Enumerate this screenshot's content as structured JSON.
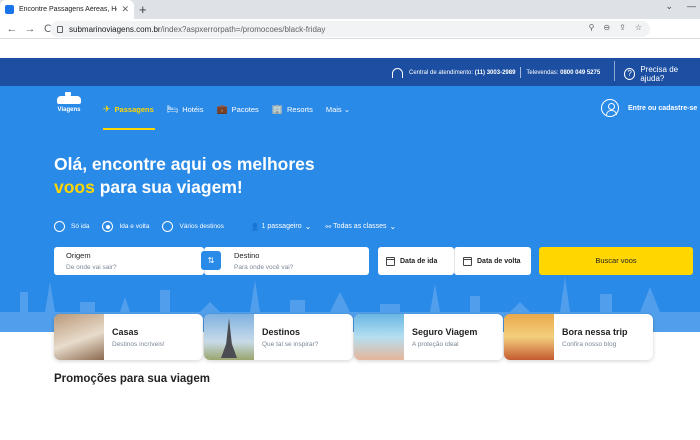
{
  "browser": {
    "tab_title": "Encontre Passagens Aéreas, Hoté",
    "tab_close": "✕",
    "new_tab": "+",
    "window_controls": [
      "⌄",
      "—"
    ],
    "url_host": "submarinoviagens.com.br",
    "url_path": "/index?aspxerrorpath=/promocoes/black-friday",
    "nav_back": "←",
    "nav_forward": "→",
    "nav_reload": "C",
    "omni_icons": [
      "⚲",
      "⊖",
      "⇪",
      "☆"
    ]
  },
  "topbar": {
    "central_label": "Central de atendimento:",
    "central_number": "(11) 3003-2989",
    "televendas_label": "Televendas:",
    "televendas_number": "0800 049 5275",
    "help": "Precisa de ajuda?"
  },
  "logo": {
    "text": "Viagens"
  },
  "nav": {
    "items": [
      {
        "label": "Passagens",
        "icon": "✈"
      },
      {
        "label": "Hotéis",
        "icon": "🛏"
      },
      {
        "label": "Pacotes",
        "icon": "💼"
      },
      {
        "label": "Resorts",
        "icon": "🏢"
      },
      {
        "label": "Mais",
        "icon": "⌄"
      }
    ],
    "account": "Entre ou cadastre-se"
  },
  "hero": {
    "line1": "Olá, encontre aqui os melhores",
    "line2_highlight": "voos",
    "line2_rest": " para sua viagem!"
  },
  "trip_types": [
    "Só ida",
    "Ida e volta",
    "Vários destinos"
  ],
  "selected_trip_type": "Ida e volta",
  "passengers": "1 passageiro",
  "classes": "Todas as classes",
  "search": {
    "origin_label": "Origem",
    "origin_placeholder": "De onde vai sair?",
    "dest_label": "Destino",
    "dest_placeholder": "Para onde você vai?",
    "date_ida": "Data de ida",
    "date_volta": "Data de volta",
    "button": "Buscar voos"
  },
  "cards": [
    {
      "title": "Casas",
      "subtitle": "Destinos incríveis!"
    },
    {
      "title": "Destinos",
      "subtitle": "Que tal se inspirar?"
    },
    {
      "title": "Seguro Viagem",
      "subtitle": "A proteção ideal"
    },
    {
      "title": "Bora nessa trip",
      "subtitle": "Confira nosso blog"
    }
  ],
  "section_title": "Promoções para sua viagem",
  "colors": {
    "topbar": "#1c4fa1",
    "hero": "#2a8ae8",
    "accent": "#ffd600"
  }
}
